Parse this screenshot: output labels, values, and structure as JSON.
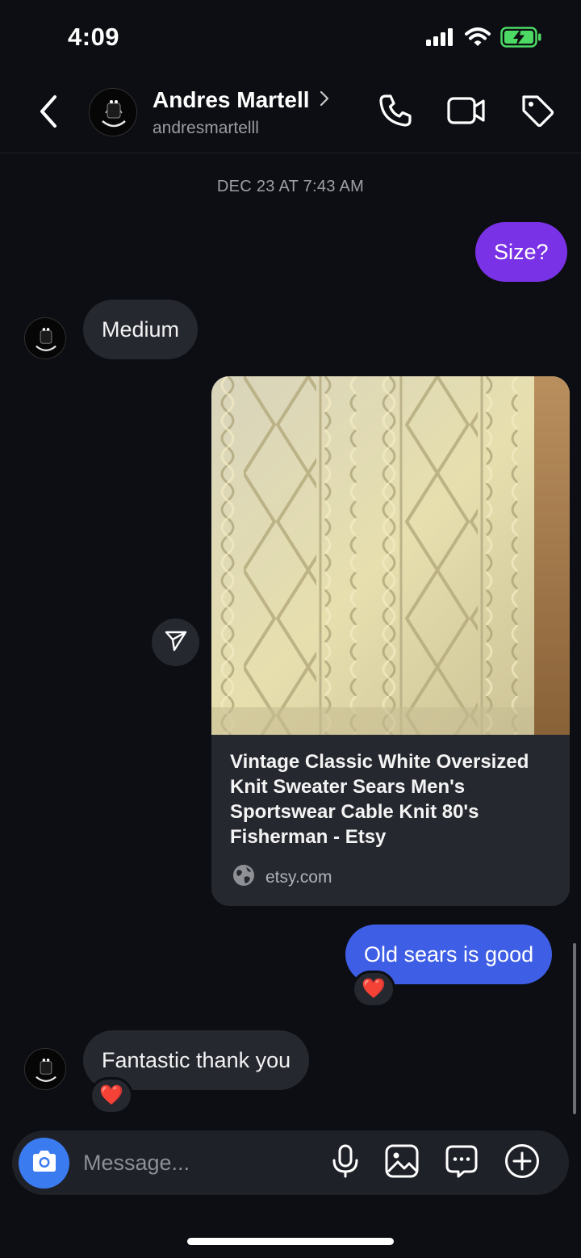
{
  "status_bar": {
    "time": "4:09",
    "icons": [
      "signal-icon",
      "wifi-icon",
      "battery-charging-icon"
    ],
    "battery_color": "#4cd964"
  },
  "header": {
    "contact_name": "Andres Martell",
    "contact_handle": "andresmartelll",
    "icons": [
      "back-icon",
      "chevron-right-icon",
      "phone-icon",
      "video-icon",
      "tag-icon"
    ]
  },
  "conversation": {
    "timestamp": "DEC 23 AT 7:43 AM",
    "messages": [
      {
        "direction": "outgoing",
        "text": "Size?",
        "color": "#7a32e6"
      },
      {
        "direction": "incoming",
        "text": "Medium"
      },
      {
        "direction": "outgoing",
        "type": "link",
        "title": "Vintage Classic White Oversized Knit Sweater Sears Men's Sportswear Cable Knit 80's Fisherman - Etsy",
        "domain": "etsy.com"
      },
      {
        "direction": "outgoing",
        "text": "Old sears is good",
        "color": "#3f5ee6",
        "reaction": "❤️"
      },
      {
        "direction": "incoming",
        "text": "Fantastic thank you",
        "reaction": "❤️"
      }
    ]
  },
  "composer": {
    "placeholder": "Message...",
    "icons": [
      "camera-icon",
      "microphone-icon",
      "gallery-icon",
      "sticker-icon",
      "add-icon"
    ],
    "camera_color": "#3a7bf0"
  }
}
